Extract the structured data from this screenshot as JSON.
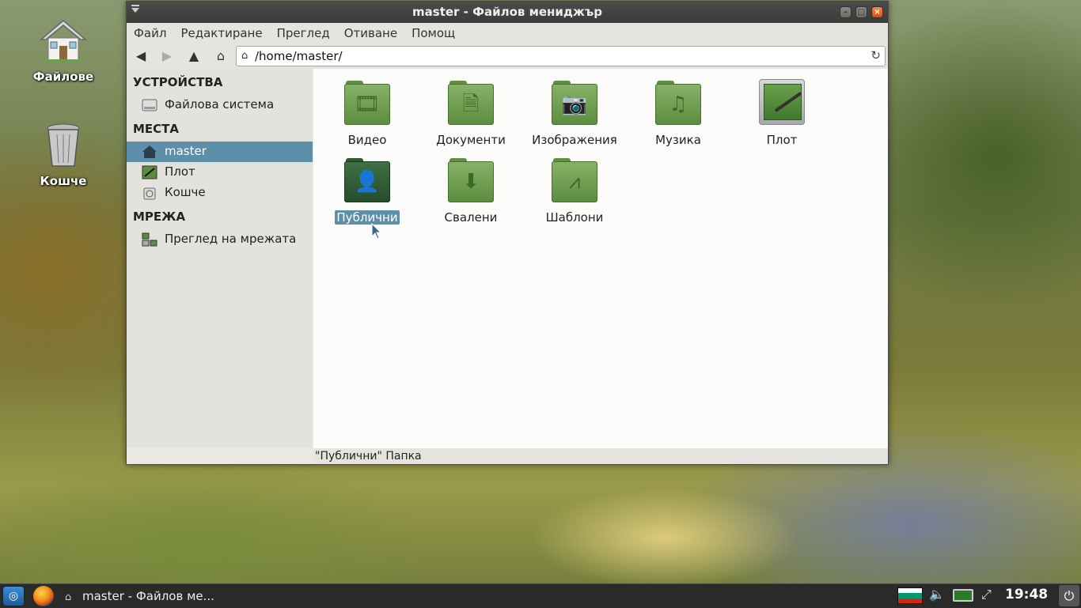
{
  "desktop": {
    "icons": [
      {
        "label": "Файлове",
        "icon": "home-folder-icon"
      },
      {
        "label": "Кошче",
        "icon": "trash-icon"
      }
    ]
  },
  "window": {
    "title": "master - Файлов мениджър",
    "menu": [
      "Файл",
      "Редактиране",
      "Преглед",
      "Отиване",
      "Помощ"
    ],
    "toolbar": {
      "back_icon": "arrow-left-icon",
      "forward_icon": "arrow-right-icon",
      "up_icon": "arrow-up-icon",
      "home_icon": "home-icon"
    },
    "path": "/home/master/",
    "sidebar": {
      "devices_header": "УСТРОЙСТВА",
      "devices": [
        {
          "label": "Файлова система",
          "icon": "drive-icon"
        }
      ],
      "places_header": "МЕСТА",
      "places": [
        {
          "label": "master",
          "icon": "home-icon",
          "selected": true
        },
        {
          "label": "Плот",
          "icon": "desktop-icon"
        },
        {
          "label": "Кошче",
          "icon": "trash-icon"
        }
      ],
      "network_header": "МРЕЖА",
      "network": [
        {
          "label": "Преглед на мрежата",
          "icon": "network-icon"
        }
      ]
    },
    "files": [
      {
        "label": "Видео",
        "icon": "video-folder-icon",
        "glyph": "🎞"
      },
      {
        "label": "Документи",
        "icon": "documents-folder-icon",
        "glyph": "🗎"
      },
      {
        "label": "Изображения",
        "icon": "pictures-folder-icon",
        "glyph": "📷"
      },
      {
        "label": "Музика",
        "icon": "music-folder-icon",
        "glyph": "♫"
      },
      {
        "label": "Плот",
        "icon": "desktop-icon",
        "glyph": ""
      },
      {
        "label": "Публични",
        "icon": "public-folder-icon",
        "glyph": "👤",
        "selected": true
      },
      {
        "label": "Свалени",
        "icon": "downloads-folder-icon",
        "glyph": "⬇"
      },
      {
        "label": "Шаблони",
        "icon": "templates-folder-icon",
        "glyph": "⩘"
      }
    ],
    "status": "\"Публични\" Папка"
  },
  "taskbar": {
    "task_label": "master - Файлов ме...",
    "clock": "19:48",
    "flag_colors": [
      "#ffffff",
      "#00966e",
      "#d62612"
    ]
  }
}
